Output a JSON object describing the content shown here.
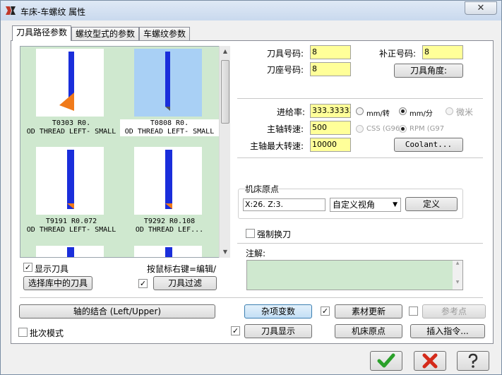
{
  "window": {
    "title": "车床-车螺纹 属性",
    "close_glyph": "✕"
  },
  "tabs": [
    {
      "label": "刀具路径参数"
    },
    {
      "label": "螺纹型式的参数"
    },
    {
      "label": "车螺纹参数"
    }
  ],
  "tools": [
    {
      "line1": "T0303 R0.",
      "line2": "OD THREAD LEFT- SMALL"
    },
    {
      "line1": "T0808 R0.",
      "line2": "OD THREAD LEFT- SMALL"
    },
    {
      "line1": "T9191 R0.072",
      "line2": "OD THREAD LEFT- SMALL"
    },
    {
      "line1": "T9292 R0.108",
      "line2": "OD THREAD LEF..."
    }
  ],
  "left": {
    "show_tool_label": "显示刀具",
    "right_click_hint": "按鼠标右键=编辑/",
    "select_lib_button": "选择库中的刀具",
    "filter_button": "刀具过滤"
  },
  "tool_numbers": {
    "tool_no_label": "刀具号码:",
    "tool_no_value": "8",
    "offset_no_label": "补正号码:",
    "offset_no_value": "8",
    "station_no_label": "刀座号码:",
    "station_no_value": "8",
    "tool_angle_button": "刀具角度:"
  },
  "feeds": {
    "feed_label": "进给率:",
    "feed_value": "333.33333",
    "mm_per_rev": "mm/转",
    "mm_per_min": "mm/分",
    "micron": "微米",
    "spindle_label": "主轴转速:",
    "spindle_value": "500",
    "css": "CSS (G96",
    "rpm": "RPM (G97",
    "max_spindle_label": "主轴最大转速:",
    "max_spindle_value": "10000",
    "coolant_button": "Coolant..."
  },
  "home": {
    "group_label": "机床原点",
    "coords": "X:26.  Z:3.",
    "combo_value": "自定义视角",
    "define_button": "定义"
  },
  "force_tool_change": "强制换刀",
  "notes_label": "注解:",
  "bottom_row": {
    "axis_combo_button": "轴的结合 (Left/Upper)",
    "misc_values_button": "杂项变数",
    "stock_update_button": "素材更新",
    "ref_point_button": "参考点",
    "batch_mode": "批次模式",
    "tool_display_button": "刀具显示",
    "machine_home_button": "机床原点",
    "insert_command_button": "插入指令..."
  },
  "colors": {
    "tool_blue": "#1a2edb",
    "insert_orange": "#f07a1a",
    "list_bg": "#cfe8cf",
    "field_yellow": "#ffff99"
  }
}
